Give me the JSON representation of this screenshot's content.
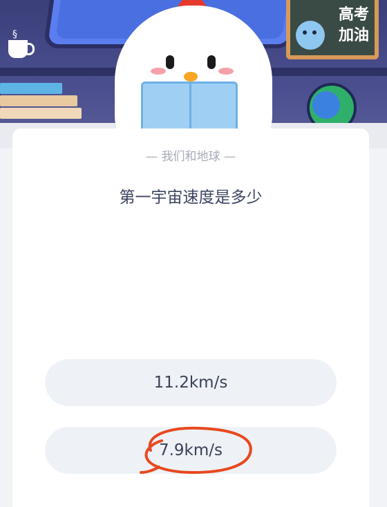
{
  "banner": {
    "blackboard_text_line1": "高考",
    "blackboard_text_line2": "加油",
    "steam_glyph": "§"
  },
  "quiz": {
    "category": "— 我们和地球 —",
    "question": "第一宇宙速度是多少",
    "options": [
      {
        "label": "11.2km/s",
        "highlighted": false
      },
      {
        "label": "7.9km/s",
        "highlighted": true
      }
    ]
  },
  "colors": {
    "annotation_circle": "#e8481f",
    "option_bg": "#eef2f6",
    "question_text": "#3c4460"
  }
}
